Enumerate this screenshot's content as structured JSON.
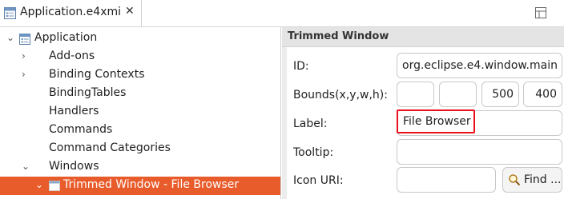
{
  "tab": {
    "title": "Application.e4xmi",
    "close_glyph": "✕",
    "icon": "e4xmi-file-icon"
  },
  "toolbar": {
    "view_menu_icon": "view-menu-icon"
  },
  "tree": {
    "root": {
      "label": "Application",
      "expanded": true,
      "icon": "application-icon"
    },
    "items": [
      {
        "label": "Add-ons",
        "twisty": "›"
      },
      {
        "label": "Binding Contexts",
        "twisty": "›"
      },
      {
        "label": "BindingTables",
        "twisty": ""
      },
      {
        "label": "Handlers",
        "twisty": ""
      },
      {
        "label": "Commands",
        "twisty": ""
      },
      {
        "label": "Command Categories",
        "twisty": ""
      },
      {
        "label": "Windows",
        "twisty": "⌄"
      }
    ],
    "selected": {
      "label": "Trimmed Window - File Browser",
      "twisty": "⌄",
      "icon": "window-icon"
    },
    "colors": {
      "selection": "#e85c2b"
    }
  },
  "editor": {
    "section_title": "Trimmed Window",
    "id_label": "ID:",
    "id_value": "org.eclipse.e4.window.main",
    "bounds_label": "Bounds(x,y,w,h):",
    "bounds": {
      "x": "",
      "y": "",
      "w": "500",
      "h": "400"
    },
    "label_label": "Label:",
    "label_value": "File Browser",
    "tooltip_label": "Tooltip:",
    "tooltip_value": "",
    "icon_uri_label": "Icon URI:",
    "icon_uri_value": "",
    "find_button": "Find ...",
    "colors": {
      "highlight": "#e8101a"
    }
  }
}
